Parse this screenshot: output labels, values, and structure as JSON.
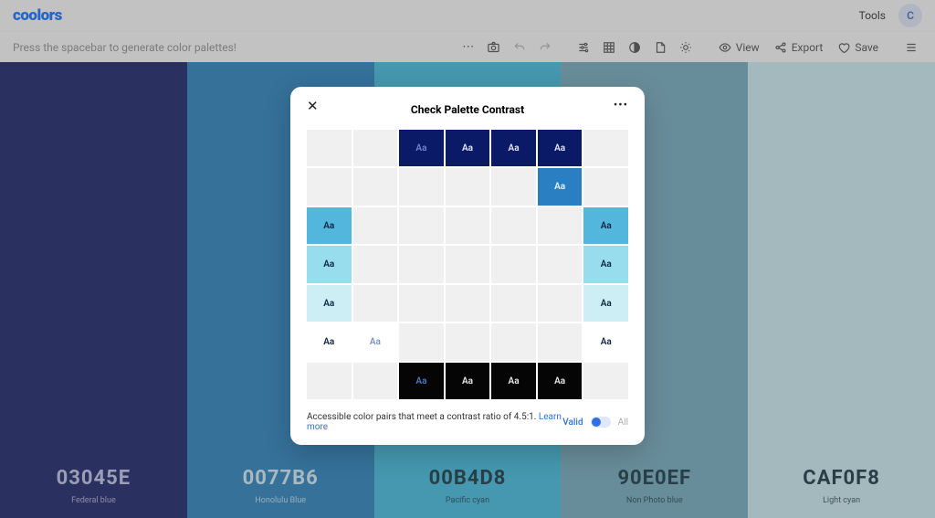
{
  "logo": "coolors",
  "tools_label": "Tools",
  "avatar_letter": "C",
  "hint": "Press the spacebar to generate color palettes!",
  "toolbar": {
    "view": "View",
    "export": "Export",
    "save": "Save"
  },
  "palette": [
    {
      "hex": "03045E",
      "name": "Federal blue",
      "bg": "#0b1660",
      "fg": "#b9bde0"
    },
    {
      "hex": "0077B6",
      "name": "Honolulu Blue",
      "bg": "#1d78b6",
      "fg": "#cfe6f2"
    },
    {
      "hex": "00B4D8",
      "name": "Pacific cyan",
      "bg": "#35b4d8",
      "fg": "#0a2b38"
    },
    {
      "hex": "90E0EF",
      "name": "Non Photo blue",
      "bg": "#6ba4b7",
      "fg": "#0a2b38"
    },
    {
      "hex": "CAF0F8",
      "name": "Light cyan",
      "bg": "#c7e7ef",
      "fg": "#0a2b38"
    }
  ],
  "modal": {
    "title": "Check Palette Contrast",
    "sample": "Aa",
    "cells": [
      {
        "r": 0,
        "c": 2,
        "bg": "#0b1a66",
        "fg": "#6e86d0"
      },
      {
        "r": 0,
        "c": 3,
        "bg": "#0b1a66",
        "fg": "#e6e9f8"
      },
      {
        "r": 0,
        "c": 4,
        "bg": "#0b1a66",
        "fg": "#e6e9f8"
      },
      {
        "r": 0,
        "c": 5,
        "bg": "#0b1a66",
        "fg": "#e6e9f8"
      },
      {
        "r": 1,
        "c": 5,
        "bg": "#2a7ec2",
        "fg": "#e9f3fb"
      },
      {
        "r": 2,
        "c": 0,
        "bg": "#52b6dd",
        "fg": "#0c2644"
      },
      {
        "r": 2,
        "c": 6,
        "bg": "#52b6dd",
        "fg": "#0c2644"
      },
      {
        "r": 3,
        "c": 0,
        "bg": "#97dded",
        "fg": "#0c2644"
      },
      {
        "r": 3,
        "c": 6,
        "bg": "#97dded",
        "fg": "#0c2644"
      },
      {
        "r": 4,
        "c": 0,
        "bg": "#cdeef5",
        "fg": "#0c2644"
      },
      {
        "r": 4,
        "c": 6,
        "bg": "#cdeef5",
        "fg": "#0c2644"
      },
      {
        "r": 5,
        "c": 0,
        "bg": "#ffffff",
        "fg": "#0c2644"
      },
      {
        "r": 5,
        "c": 1,
        "bg": "#ffffff",
        "fg": "#7c92c2"
      },
      {
        "r": 5,
        "c": 6,
        "bg": "#ffffff",
        "fg": "#0c2644"
      },
      {
        "r": 6,
        "c": 2,
        "bg": "#050505",
        "fg": "#4f79c4"
      },
      {
        "r": 6,
        "c": 3,
        "bg": "#050505",
        "fg": "#e9e9e9"
      },
      {
        "r": 6,
        "c": 4,
        "bg": "#050505",
        "fg": "#e9e9e9"
      },
      {
        "r": 6,
        "c": 5,
        "bg": "#050505",
        "fg": "#e9e9e9"
      }
    ],
    "footer_text": "Accessible color pairs that meet a contrast ratio of 4.5:1.",
    "learn_more": "Learn more",
    "valid_label": "Valid",
    "all_label": "All"
  }
}
